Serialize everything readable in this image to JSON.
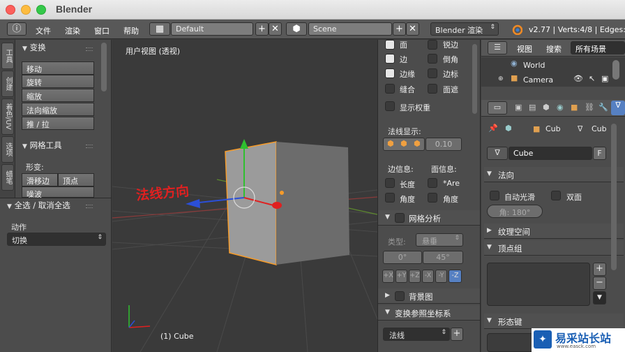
{
  "window": {
    "title": "Blender"
  },
  "infobar": {
    "menu": [
      "文件",
      "渲染",
      "窗口",
      "帮助"
    ],
    "layout": "Default",
    "scene": "Scene",
    "engine": "Blender 渲染",
    "stats": "v2.77 | Verts:4/8 | Edges:4/"
  },
  "toolshelf": {
    "tabs": [
      "工具",
      "创建",
      "着色/UV",
      "选项",
      "蜡笔"
    ],
    "transform_title": "变换",
    "transform_buttons": [
      "移动",
      "旋转",
      "缩放",
      "法向缩放",
      "推 / 拉"
    ],
    "mesh_tools_title": "网格工具",
    "deform_label": "形变:",
    "slide_edge": "滑移边",
    "vertex": "顶点",
    "smooth": "噪波"
  },
  "operator": {
    "title": "全选 / 取消全选",
    "action_label": "动作",
    "action_value": "切换"
  },
  "viewport": {
    "header": "用户视图 (透视)",
    "annotation": "法线方向",
    "object_label": "(1) Cube",
    "annotation_color": "#e02020"
  },
  "overlay": {
    "face": "面",
    "sharp": "锐边",
    "edge": "边",
    "bevel": "倒角",
    "seam": "边缘",
    "edge_marks": "边标",
    "crease": "缝合",
    "face_area": "面遮",
    "show_weights": "显示权重",
    "normals_label": "法线显示:",
    "normal_size": "0.10",
    "edge_info": "边信息:",
    "face_info": "面信息:",
    "length": "长度",
    "area": "*Are",
    "angle": "角度",
    "face_angle": "角度",
    "mesh_analysis": "网格分析",
    "type_label": "类型:",
    "type_value": "悬垂",
    "min": "0°",
    "max": "45°",
    "axes": [
      "+X",
      "+Y",
      "+Z",
      "-X",
      "-Y",
      "-Z"
    ],
    "background_images": "背景图",
    "transform_orientations": "变换参照坐标系",
    "orientation_value": "法线"
  },
  "outliner": {
    "view": "视图",
    "search": "搜索",
    "all_scenes": "所有场景",
    "world": "World",
    "camera": "Camera"
  },
  "properties": {
    "breadcrumb": [
      "Cub",
      "Cub"
    ],
    "data_name": "Cube",
    "fake_user": "F",
    "normals_title": "法向",
    "auto_smooth": "自动光滑",
    "double_sided": "双面",
    "angle": "角:  180°",
    "texture_space": "纹理空间",
    "vertex_groups": "顶点组",
    "shape_keys": "形态键"
  },
  "watermark": {
    "text": "易采站长站",
    "sub": "www.easck.com"
  }
}
